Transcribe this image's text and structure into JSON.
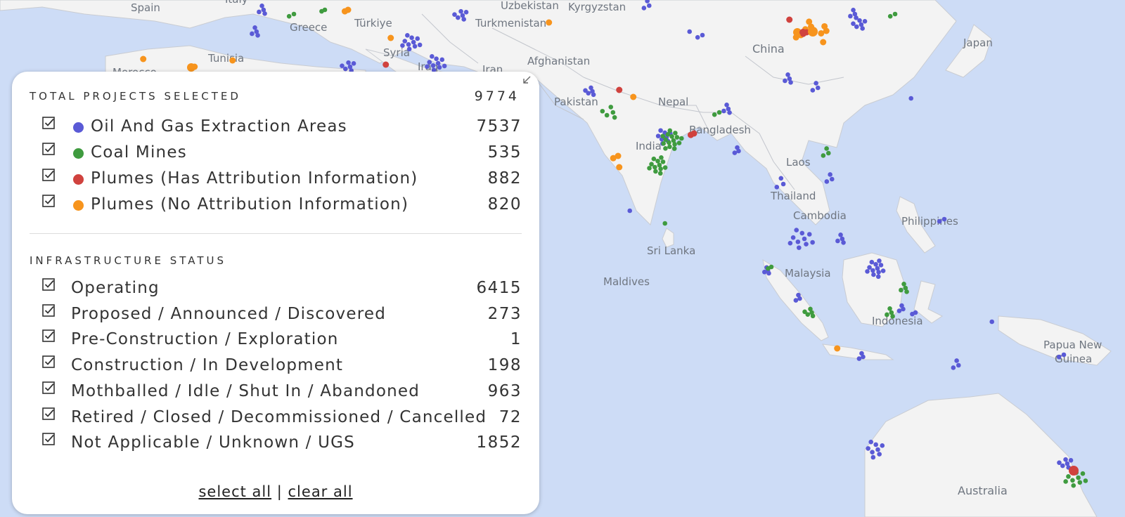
{
  "colors": {
    "ocean": "#cddcf6",
    "land": "#f3f3f3",
    "oil_gas": "#5a5ad6",
    "coal": "#3f9b3f",
    "plume_attr": "#d0423e",
    "plume_noattr": "#f7941d"
  },
  "map_labels": [
    "Spain",
    "Italy",
    "Greece",
    "Türkiye",
    "Uzbekistan",
    "Kyrgyzstan",
    "Turkmenistan",
    "Tunisia",
    "Morocco",
    "Syria",
    "Iraq",
    "Iran",
    "Afghanistan",
    "Pakistan",
    "Nepal",
    "China",
    "Japan",
    "India",
    "Bangladesh",
    "Laos",
    "Thailand",
    "Cambodia",
    "Philippines",
    "Sri Lanka",
    "Maldives",
    "Malaysia",
    "Indonesia",
    "Papua New",
    "Guinea",
    "Australia"
  ],
  "panel": {
    "collapse_icon": "collapse-arrow-icon",
    "total_title": "TOTAL PROJECTS SELECTED",
    "total_value": "9774",
    "types": [
      {
        "label": "Oil And Gas Extraction Areas",
        "count": "7537",
        "color": "#5a5ad6",
        "checked": true
      },
      {
        "label": "Coal Mines",
        "count": "535",
        "color": "#3f9b3f",
        "checked": true
      },
      {
        "label": "Plumes (Has Attribution Information)",
        "count": "882",
        "color": "#d0423e",
        "checked": true
      },
      {
        "label": "Plumes (No Attribution Information)",
        "count": "820",
        "color": "#f7941d",
        "checked": true
      }
    ],
    "status_title": "INFRASTRUCTURE STATUS",
    "statuses": [
      {
        "label": "Operating",
        "count": "6415",
        "checked": true
      },
      {
        "label": "Proposed / Announced / Discovered",
        "count": "273",
        "checked": true
      },
      {
        "label": "Pre-Construction / Exploration",
        "count": "1",
        "checked": true
      },
      {
        "label": "Construction / In Development",
        "count": "198",
        "checked": true
      },
      {
        "label": "Mothballed / Idle / Shut In / Abandoned",
        "count": "963",
        "checked": true
      },
      {
        "label": "Retired / Closed / Decommissioned / Cancelled",
        "count": "72",
        "checked": true
      },
      {
        "label": "Not Applicable / Unknown / UGS",
        "count": "1852",
        "checked": true
      }
    ],
    "select_all": "select all",
    "separator": "|",
    "clear_all": "clear all"
  }
}
